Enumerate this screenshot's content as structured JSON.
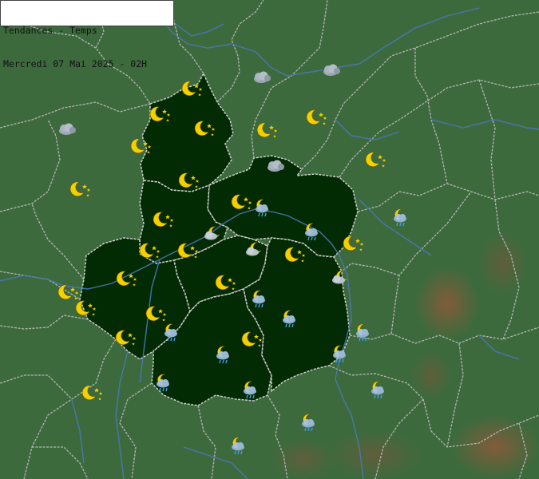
{
  "header": {
    "line1": "Tendances - Temps",
    "line2": "Mercredi 07 Mai 2025 - 02H"
  },
  "colors": {
    "background": "#3d6a3d",
    "region_fill": "#032b03",
    "border": "#b4b4b4",
    "river": "#4a78b8",
    "relief": "#8a5a3a",
    "moon": "#f5d000",
    "cloud": "#9aa6b2",
    "rain": "#3fa0e8"
  },
  "legend_icons": {
    "clear_night": "moon-stars-icon",
    "cloudy": "cloud-icon",
    "showers_night": "moon-cloud-rain-icon",
    "partly_cloudy_night": "moon-cloud-icon"
  }
}
